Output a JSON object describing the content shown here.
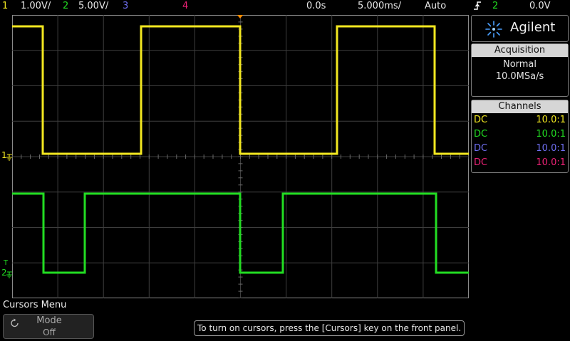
{
  "topbar": {
    "ch1_num": "1",
    "ch1_scale": "1.00V/",
    "ch2_num": "2",
    "ch2_scale": "5.00V/",
    "ch3_num": "3",
    "ch4_num": "4",
    "time_offset": "0.0s",
    "timebase": "5.000ms/",
    "trigger_mode": "Auto",
    "trigger_source": "2",
    "trigger_level": "0.0V"
  },
  "brand": {
    "name": "Agilent"
  },
  "acquisition": {
    "title": "Acquisition",
    "mode": "Normal",
    "rate": "10.0MSa/s"
  },
  "channels": {
    "title": "Channels",
    "rows": [
      {
        "coupling": "DC",
        "probe": "10.0:1",
        "color": "#f3e820"
      },
      {
        "coupling": "DC",
        "probe": "10.0:1",
        "color": "#22dd22"
      },
      {
        "coupling": "DC",
        "probe": "10.0:1",
        "color": "#6f6ff2"
      },
      {
        "coupling": "DC",
        "probe": "10.0:1",
        "color": "#ee2277"
      }
    ]
  },
  "markers": {
    "ch1": "1",
    "ch2": "2",
    "trigger": "T"
  },
  "menu": {
    "title": "Cursors Menu",
    "mode_label": "Mode",
    "mode_value": "Off"
  },
  "hint": "To turn on cursors, press the [Cursors] key on the front panel.",
  "colors": {
    "ch1": "#f3e820",
    "ch2": "#22dd22",
    "ch3": "#6f6ff2",
    "ch4": "#ee2277",
    "trigger": "#ff8c00"
  },
  "icons": {
    "trigger_slope": "rising-edge-icon",
    "brand_logo": "spark-icon",
    "mode_softkey": "rotate-knob-icon"
  }
}
